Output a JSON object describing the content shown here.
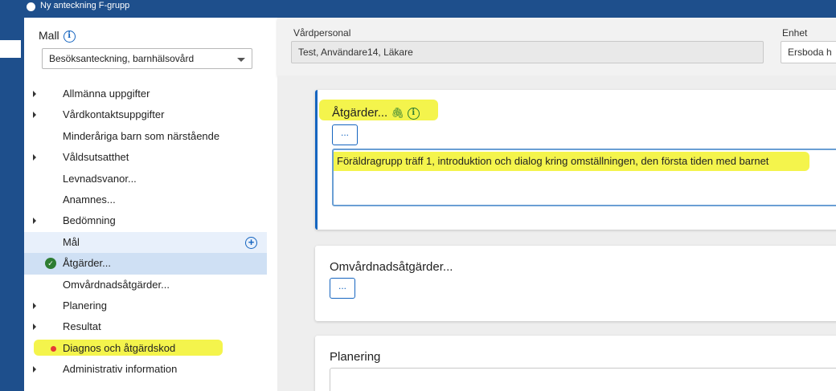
{
  "window": {
    "title": "Ny anteckning F-grupp"
  },
  "sidebar": {
    "mall_label": "Mall",
    "mall_value": "Besöksanteckning, barnhälsovård",
    "items": [
      {
        "label": "Allmänna uppgifter",
        "expandable": true
      },
      {
        "label": "Vårdkontaktsuppgifter",
        "expandable": true
      },
      {
        "label": "Minderåriga barn som närstående",
        "expandable": false
      },
      {
        "label": "Våldsutsatthet",
        "expandable": true
      },
      {
        "label": "Levnadsvanor...",
        "expandable": false
      },
      {
        "label": "Anamnes...",
        "expandable": false
      },
      {
        "label": "Bedömning",
        "expandable": true
      },
      {
        "label": "Mål",
        "expandable": false,
        "state": "hover"
      },
      {
        "label": "Åtgärder...",
        "expandable": false,
        "state": "completed"
      },
      {
        "label": "Omvårdnadsåtgärder...",
        "expandable": false
      },
      {
        "label": "Planering",
        "expandable": true
      },
      {
        "label": "Resultat",
        "expandable": true
      },
      {
        "label": "Diagnos och åtgärdskod",
        "expandable": false,
        "state": "required"
      },
      {
        "label": "Administrativ information",
        "expandable": true
      }
    ]
  },
  "header": {
    "vardpersonal_label": "Vårdpersonal",
    "vardpersonal_value": "Test, Användare14, Läkare",
    "enhet_label": "Enhet",
    "enhet_value": "Ersboda h"
  },
  "main": {
    "atgarder": {
      "title": "Åtgärder...",
      "dots_label": "...",
      "text": "Föräldragrupp träff 1, introduktion och dialog kring omställningen, den första tiden med barnet"
    },
    "omvardnad": {
      "title": "Omvårdnadsåtgärder...",
      "dots_label": "..."
    },
    "planering": {
      "title": "Planering"
    }
  },
  "colors": {
    "accent": "#1565c0",
    "titlebar": "#1e4f8c",
    "highlight": "#f0f000",
    "check": "#2e7d32",
    "required": "#e53935"
  }
}
